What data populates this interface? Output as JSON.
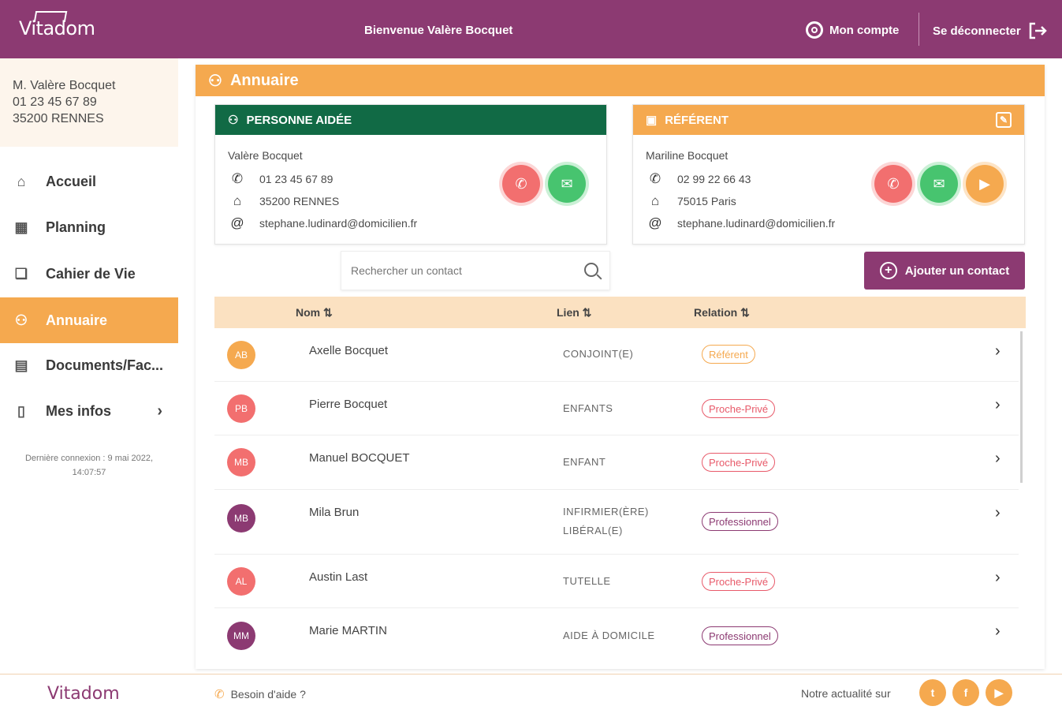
{
  "header": {
    "logo": "Vitadom",
    "welcome": "Bienvenue Valère Bocquet",
    "account_label": "Mon compte",
    "logout_label": "Se déconnecter"
  },
  "user": {
    "name": "M. Valère Bocquet",
    "phone": "01 23 45 67 89",
    "city": "35200 RENNES"
  },
  "nav": {
    "items": [
      {
        "label": "Accueil",
        "icon": "home-icon"
      },
      {
        "label": "Planning",
        "icon": "calendar-icon"
      },
      {
        "label": "Cahier de Vie",
        "icon": "book-icon"
      },
      {
        "label": "Annuaire",
        "icon": "people-icon"
      },
      {
        "label": "Documents/Fac...",
        "icon": "document-icon"
      },
      {
        "label": "Mes infos",
        "icon": "id-card-icon"
      }
    ],
    "last_login": "Dernière connexion : 9 mai 2022, 14:07:57"
  },
  "page": {
    "title": "Annuaire"
  },
  "aidee": {
    "title": "PERSONNE AIDÉE",
    "name": "Valère Bocquet",
    "phone": "01 23 45 67 89",
    "city": "35200 RENNES",
    "email": "stephane.ludinard@domicilien.fr"
  },
  "referent": {
    "title": "RÉFÉRENT",
    "name": "Mariline Bocquet",
    "phone": "02 99 22 66 43",
    "city": "75015 Paris",
    "email": "stephane.ludinard@domicilien.fr"
  },
  "search": {
    "placeholder": "Rechercher un contact"
  },
  "add_button": "Ajouter un contact",
  "table": {
    "headers": {
      "name": "Nom",
      "lien": "Lien",
      "relation": "Relation"
    },
    "rows": [
      {
        "initials": "AB",
        "name": "Axelle Bocquet",
        "lien": "CONJOINT(E)",
        "relation": "Référent",
        "avatar_color": "#f5a94f"
      },
      {
        "initials": "PB",
        "name": "Pierre Bocquet",
        "lien": "ENFANTS",
        "relation": "Proche-Privé",
        "avatar_color": "#f26f6f"
      },
      {
        "initials": "MB",
        "name": "Manuel BOCQUET",
        "lien": "ENFANT",
        "relation": "Proche-Privé",
        "avatar_color": "#f26f6f"
      },
      {
        "initials": "MB",
        "name": "Mila Brun",
        "lien": "INFIRMIER(ÈRE) LIBÉRAL(E)",
        "relation": "Professionnel",
        "avatar_color": "#8c3a72"
      },
      {
        "initials": "AL",
        "name": "Austin Last",
        "lien": "TUTELLE",
        "relation": "Proche-Privé",
        "avatar_color": "#f26f6f"
      },
      {
        "initials": "MM",
        "name": "Marie MARTIN",
        "lien": "AIDE À DOMICILE",
        "relation": "Professionnel",
        "avatar_color": "#8c3a72"
      }
    ]
  },
  "footer": {
    "logo": "Vitadom",
    "help": "Besoin d'aide ?",
    "news": "Notre actualité sur"
  },
  "colors": {
    "brand": "#8c3a72",
    "accent": "#f5a94f",
    "green": "#116a45"
  }
}
